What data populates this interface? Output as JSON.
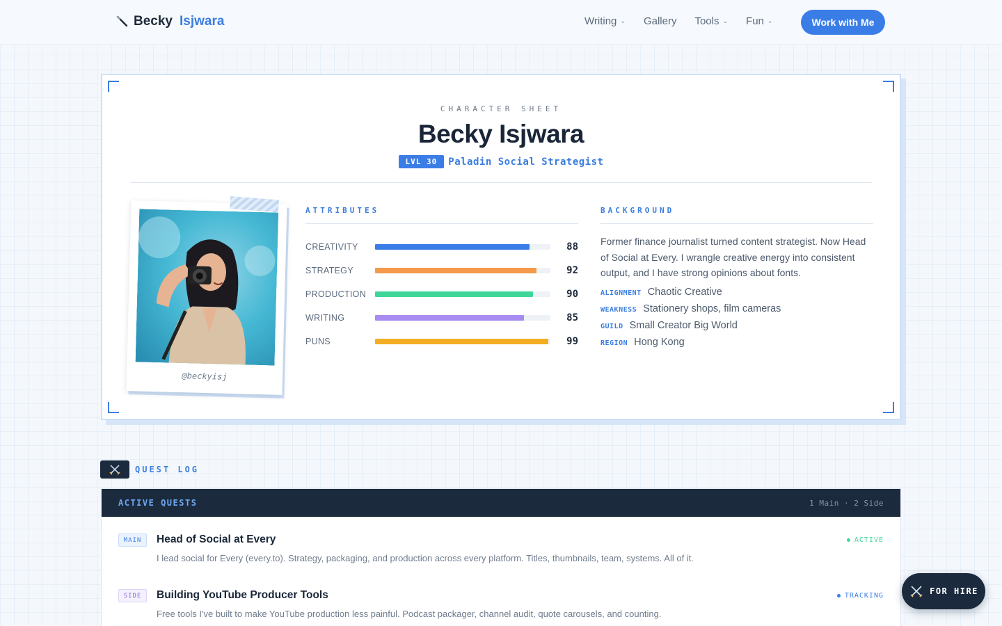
{
  "nav": {
    "logo_first": "Becky",
    "logo_last": "Isjwara",
    "links": [
      {
        "label": "Writing",
        "has_dropdown": true
      },
      {
        "label": "Gallery",
        "has_dropdown": false
      },
      {
        "label": "Tools",
        "has_dropdown": true
      },
      {
        "label": "Fun",
        "has_dropdown": true
      }
    ],
    "cta_label": "Work with Me"
  },
  "sheet": {
    "eyebrow": "CHARACTER SHEET",
    "name": "Becky Isjwara",
    "level": "LVL 30",
    "class_name": "Paladin Social Strategist",
    "photo_caption": "@beckyisj",
    "attributes_label": "ATTRIBUTES",
    "attributes": [
      {
        "name": "CREATIVITY",
        "value": 88,
        "color": "#3b7de6"
      },
      {
        "name": "STRATEGY",
        "value": 92,
        "color": "#f5994a"
      },
      {
        "name": "PRODUCTION",
        "value": 90,
        "color": "#3fd69a"
      },
      {
        "name": "WRITING",
        "value": 85,
        "color": "#a78bf0"
      },
      {
        "name": "PUNS",
        "value": 99,
        "color": "#f3ad22"
      }
    ],
    "background_label": "BACKGROUND",
    "bio": "Former finance journalist turned content strategist. Now Head of Social at Every. I wrangle creative energy into consistent output, and I have strong opinions about fonts.",
    "facts": [
      {
        "key": "ALIGNMENT",
        "value": "Chaotic Creative"
      },
      {
        "key": "WEAKNESS",
        "value": "Stationery shops, film cameras"
      },
      {
        "key": "GUILD",
        "value": "Small Creator Big World"
      },
      {
        "key": "REGION",
        "value": "Hong Kong"
      }
    ]
  },
  "quest_log": {
    "title": "QUEST LOG",
    "header_left": "ACTIVE QUESTS",
    "header_right": "1 Main · 2 Side",
    "quests": [
      {
        "tag": "MAIN",
        "title": "Head of Social at Every",
        "status": "ACTIVE",
        "status_color": "#3fd69a",
        "description": "I lead social for Every (every.to). Strategy, packaging, and production across every platform. Titles, thumbnails, team, systems. All of it."
      },
      {
        "tag": "SIDE",
        "title": "Building YouTube Producer Tools",
        "status": "TRACKING",
        "status_color": "#3b7de6",
        "description": "Free tools I've built to make YouTube production less painful. Podcast packager, channel audit, quote carousels, and counting."
      }
    ]
  },
  "hire_button": {
    "label": "FOR HIRE",
    "icon": "crossed-swords-icon"
  },
  "colors": {
    "accent": "#3b7de6",
    "dark": "#1b2a3d"
  }
}
